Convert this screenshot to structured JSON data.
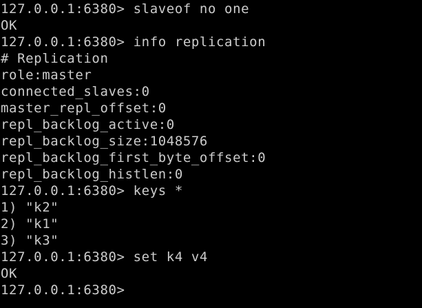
{
  "terminal": {
    "lines": [
      "127.0.0.1:6380> slaveof no one",
      "OK",
      "127.0.0.1:6380> info replication",
      "# Replication",
      "role:master",
      "connected_slaves:0",
      "master_repl_offset:0",
      "repl_backlog_active:0",
      "repl_backlog_size:1048576",
      "repl_backlog_first_byte_offset:0",
      "repl_backlog_histlen:0",
      "127.0.0.1:6380> keys *",
      "1) \"k2\"",
      "2) \"k1\"",
      "3) \"k3\"",
      "127.0.0.1:6380> set k4 v4",
      "OK",
      "127.0.0.1:6380>"
    ]
  },
  "colors": {
    "background": "#000000",
    "foreground": "#cccccc"
  }
}
